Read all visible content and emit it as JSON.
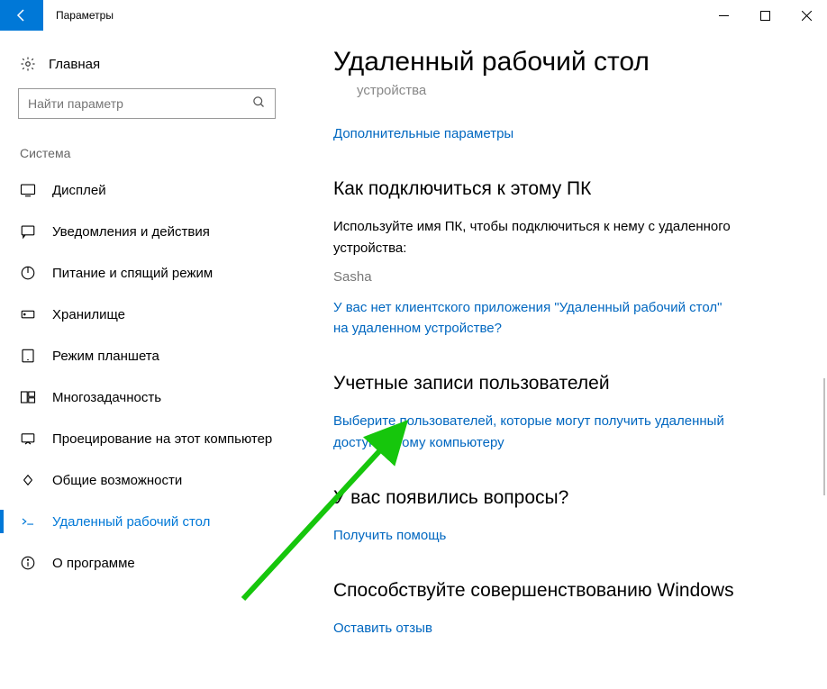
{
  "window": {
    "title": "Параметры"
  },
  "sidebar": {
    "home_label": "Главная",
    "search_placeholder": "Найти параметр",
    "group_label": "Система",
    "items": [
      {
        "label": "Дисплей",
        "name": "nav-display"
      },
      {
        "label": "Уведомления и действия",
        "name": "nav-notifications"
      },
      {
        "label": "Питание и спящий режим",
        "name": "nav-power"
      },
      {
        "label": "Хранилище",
        "name": "nav-storage"
      },
      {
        "label": "Режим планшета",
        "name": "nav-tablet"
      },
      {
        "label": "Многозадачность",
        "name": "nav-multitask"
      },
      {
        "label": "Проецирование на этот компьютер",
        "name": "nav-projecting"
      },
      {
        "label": "Общие возможности",
        "name": "nav-shared"
      },
      {
        "label": "Удаленный рабочий стол",
        "name": "nav-remote",
        "active": true
      },
      {
        "label": "О программе",
        "name": "nav-about"
      }
    ]
  },
  "main": {
    "title": "Удаленный рабочий стол",
    "device_sub": "устройства",
    "advanced_link": "Дополнительные параметры",
    "connect": {
      "heading": "Как подключиться к этому ПК",
      "body": "Используйте имя ПК, чтобы подключиться к нему с удаленного устройства:",
      "pc_name": "Sasha",
      "client_link": "У вас нет клиентского приложения \"Удаленный рабочий стол\" на удаленном устройстве?"
    },
    "accounts": {
      "heading": "Учетные записи пользователей",
      "select_users_link": "Выберите пользователей, которые могут получить удаленный доступ к этому компьютеру"
    },
    "help": {
      "heading": "У вас появились вопросы?",
      "link": "Получить помощь"
    },
    "feedback": {
      "heading": "Способствуйте совершенствованию Windows",
      "link": "Оставить отзыв"
    }
  }
}
